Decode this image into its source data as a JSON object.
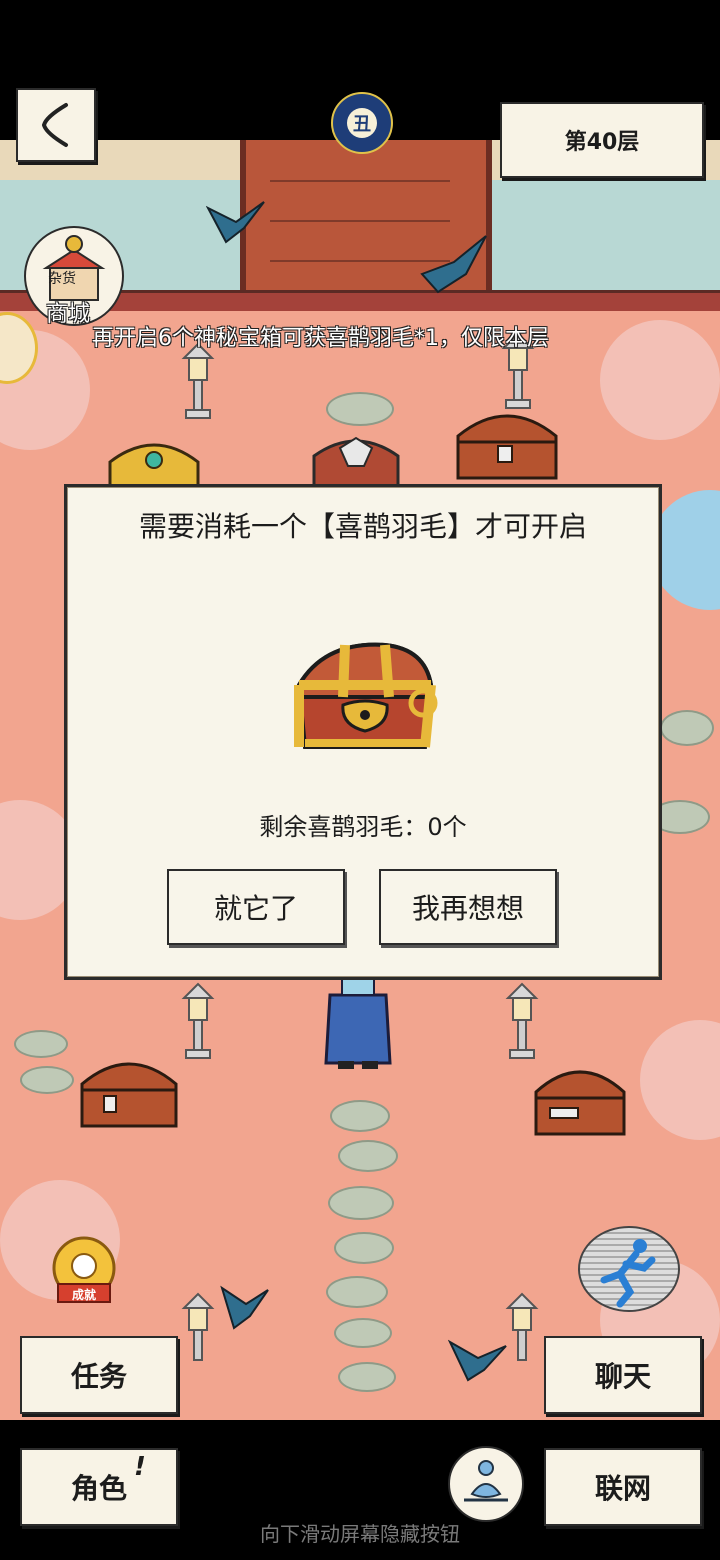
{
  "header": {
    "back_icon": "chevron-left-icon",
    "zodiac_badge": "丑",
    "floor_label": "第40层"
  },
  "hud": {
    "shop_label": "商城",
    "shop_sign": "杂货",
    "banner_text": "再开启6个神秘宝箱可获喜鹊羽毛*1，仅限本层"
  },
  "dialog": {
    "title": "需要消耗一个【喜鹊羽毛】才可开启",
    "remaining_text": "剩余喜鹊羽毛：0个",
    "confirm_label": "就它了",
    "cancel_label": "我再想想"
  },
  "menu": {
    "achievement_label": "成就",
    "task_label": "任务",
    "chat_label": "聊天",
    "character_label": "角色",
    "character_alert": "!",
    "network_label": "联网"
  },
  "footer": {
    "hint_text": "向下滑动屏幕隐藏按钮"
  },
  "colors": {
    "ground": "#f2a58f",
    "paper": "#f8f5ea",
    "wood": "#b9563a",
    "gold": "#e7b93a"
  }
}
